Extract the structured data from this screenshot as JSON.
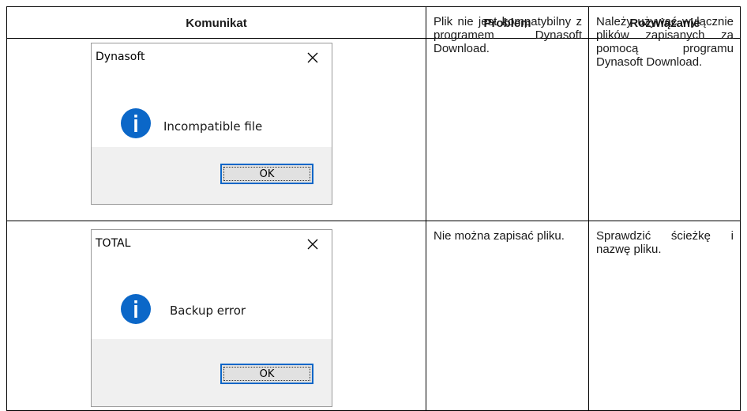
{
  "headers": {
    "message": "Komunikat",
    "problem": "Problem",
    "solution": "Rozwiązanie"
  },
  "rows": [
    {
      "dialog": {
        "title": "Dynasoft",
        "message": "Incompatible file",
        "ok_label": "OK",
        "icon": "info-icon"
      },
      "problem": "Plik nie jest kompatybilny z programem Dynasoft Download.",
      "solution": "Należy używać wyłącznie plików zapisanych za pomocą programu Dynasoft Download."
    },
    {
      "dialog": {
        "title": "TOTAL",
        "message": "Backup error",
        "ok_label": "OK",
        "icon": "info-icon"
      },
      "problem": "Nie można zapisać pliku.",
      "solution": "Sprawdzić ścieżkę i nazwę pliku."
    }
  ],
  "colors": {
    "info_icon": "#0b67c8",
    "focus_border": "#0b67c8",
    "dialog_footer": "#f0f0f0"
  }
}
